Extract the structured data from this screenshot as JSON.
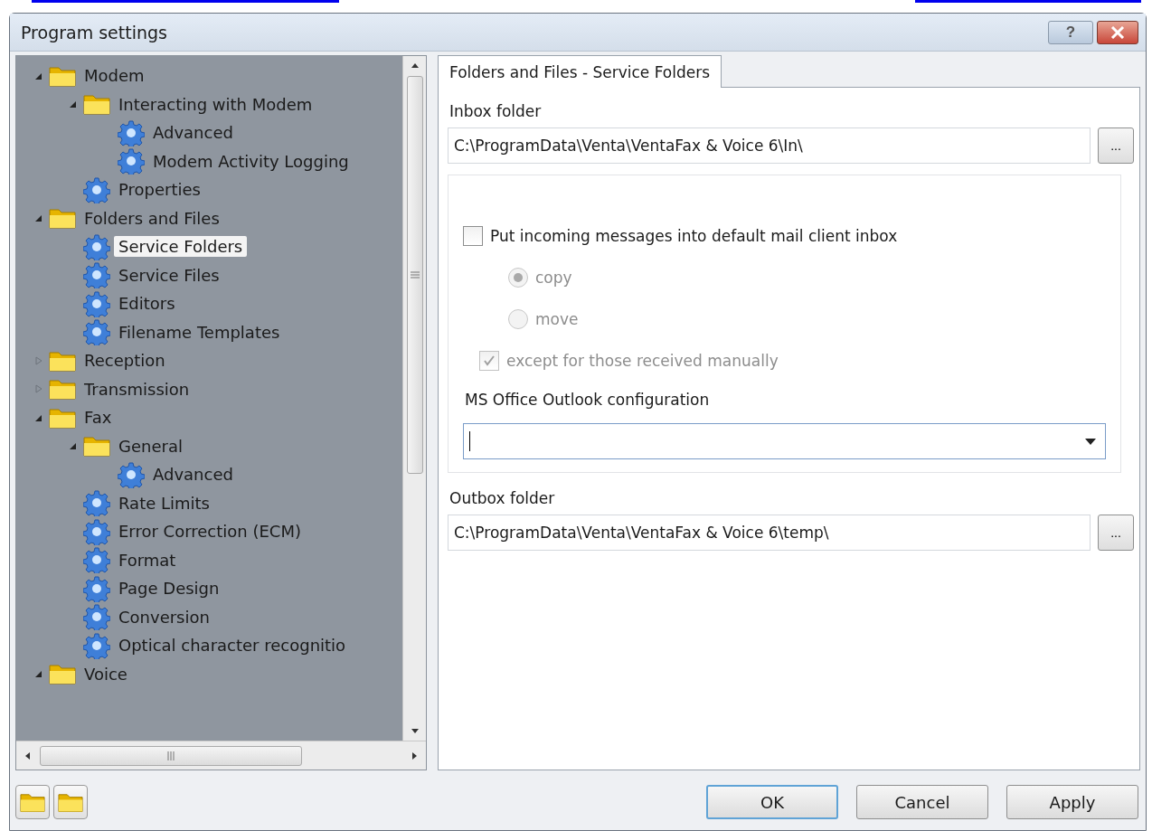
{
  "window": {
    "title": "Program settings",
    "help_button": "?"
  },
  "tree": {
    "items": [
      {
        "label": "Modem",
        "kind": "folder",
        "expanded": true,
        "selected": false,
        "children": [
          {
            "label": "Interacting with Modem",
            "kind": "folder",
            "expanded": true,
            "selected": false,
            "children": [
              {
                "label": "Advanced",
                "kind": "settings",
                "selected": false
              },
              {
                "label": "Modem Activity Logging",
                "kind": "settings",
                "selected": false
              }
            ]
          },
          {
            "label": "Properties",
            "kind": "settings",
            "selected": false
          }
        ]
      },
      {
        "label": "Folders and Files",
        "kind": "folder",
        "expanded": true,
        "selected": false,
        "children": [
          {
            "label": "Service Folders",
            "kind": "settings",
            "selected": true
          },
          {
            "label": "Service Files",
            "kind": "settings",
            "selected": false
          },
          {
            "label": "Editors",
            "kind": "settings",
            "selected": false
          },
          {
            "label": "Filename Templates",
            "kind": "settings",
            "selected": false
          }
        ]
      },
      {
        "label": "Reception",
        "kind": "folder",
        "expanded": false,
        "selected": false
      },
      {
        "label": "Transmission",
        "kind": "folder",
        "expanded": false,
        "selected": false
      },
      {
        "label": "Fax",
        "kind": "folder",
        "expanded": true,
        "selected": false,
        "children": [
          {
            "label": "General",
            "kind": "folder",
            "expanded": true,
            "selected": false,
            "children": [
              {
                "label": "Advanced",
                "kind": "settings",
                "selected": false
              }
            ]
          },
          {
            "label": "Rate Limits",
            "kind": "settings",
            "selected": false
          },
          {
            "label": "Error Correction (ECM)",
            "kind": "settings",
            "selected": false
          },
          {
            "label": "Format",
            "kind": "settings",
            "selected": false
          },
          {
            "label": "Page Design",
            "kind": "settings",
            "selected": false
          },
          {
            "label": "Conversion",
            "kind": "settings",
            "selected": false
          },
          {
            "label": "Optical character recognitio",
            "kind": "settings",
            "selected": false
          }
        ]
      },
      {
        "label": "Voice",
        "kind": "folder",
        "expanded": true,
        "selected": false
      }
    ]
  },
  "tabs": [
    {
      "label": "Folders and Files - Service Folders",
      "selected": true
    }
  ],
  "inbox": {
    "label": "Inbox folder",
    "value": "C:\\ProgramData\\Venta\\VentaFax & Voice 6\\In\\",
    "browse": "..."
  },
  "mail_option": {
    "label": "Put incoming messages into default mail client inbox",
    "checked": false,
    "disabled": false
  },
  "mode": [
    {
      "label": "copy",
      "selected": true,
      "disabled": true
    },
    {
      "label": "move",
      "selected": false,
      "disabled": true
    }
  ],
  "except_manual": {
    "label": "except for those received manually",
    "checked": true,
    "disabled": true
  },
  "outlook": {
    "label": "MS Office Outlook configuration"
  },
  "outbox": {
    "label": "Outbox folder",
    "value": "C:\\ProgramData\\Venta\\VentaFax & Voice 6\\temp\\",
    "browse": "..."
  },
  "buttons": [
    {
      "label": "OK",
      "default": true
    },
    {
      "label": "Cancel",
      "default": false
    },
    {
      "label": "Apply",
      "default": false
    }
  ]
}
